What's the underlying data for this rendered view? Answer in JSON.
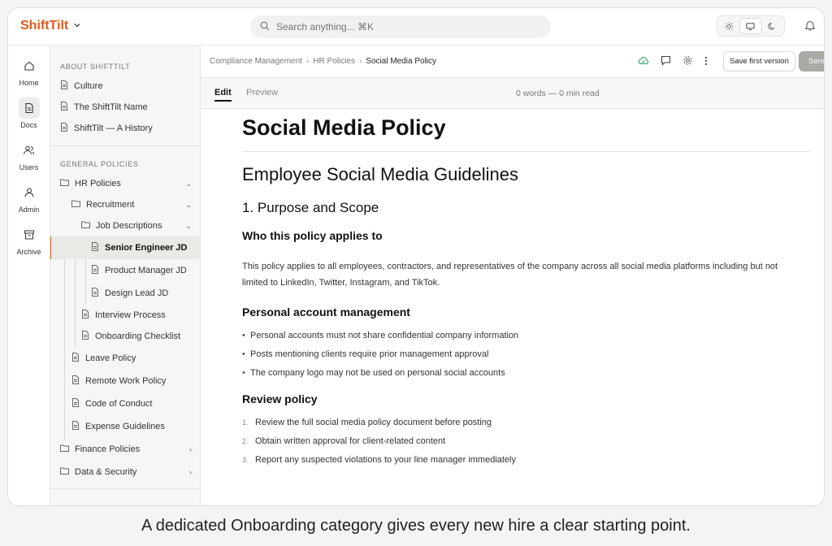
{
  "app": {
    "brand": "ShiftTilt"
  },
  "search": {
    "placeholder": "Search anything... ⌘K"
  },
  "theme_toggle": [
    "light",
    "system",
    "dark"
  ],
  "rail": [
    {
      "label": "Home",
      "icon": "home-icon"
    },
    {
      "label": "Docs",
      "icon": "document-icon",
      "active": true
    },
    {
      "label": "Users",
      "icon": "users-icon"
    },
    {
      "label": "Admin",
      "icon": "admin-icon"
    },
    {
      "label": "Archive",
      "icon": "archive-icon"
    }
  ],
  "sidebar": {
    "about_title": "ABOUT SHIFTTILT",
    "about_items": [
      "Culture",
      "The ShiftTilt Name",
      "ShiftTilt — A History"
    ],
    "general_title": "GENERAL POLICIES",
    "tree": {
      "hr": "HR Policies",
      "recruitment": "Recruitment",
      "job_descriptions": "Job Descriptions",
      "senior": "Senior Engineer JD",
      "product": "Product Manager JD",
      "design": "Design Lead JD",
      "interview": "Interview Process",
      "onboarding": "Onboarding Checklist",
      "leave": "Leave Policy",
      "remote": "Remote Work Policy",
      "conduct": "Code of Conduct",
      "expense": "Expense Guidelines",
      "finance": "Finance Policies",
      "data": "Data & Security"
    }
  },
  "breadcrumb": [
    "Compliance Management",
    "HR Policies",
    "Social Media Policy"
  ],
  "toolbar": {
    "save_label": "Save first version",
    "send_label": "Send"
  },
  "editor": {
    "tab_edit": "Edit",
    "tab_preview": "Preview",
    "word_count": "0 words — 0 min read"
  },
  "doc": {
    "title": "Social Media Policy",
    "h2": "Employee Social Media Guidelines",
    "h3": "1. Purpose and Scope",
    "h4_applies": "Who this policy applies to",
    "para": "This policy applies to all employees, contractors, and representatives of the company across all social media platforms including but not limited to LinkedIn, Twitter, Instagram, and TikTok.",
    "h4_personal": "Personal account management",
    "bullets": [
      "Personal accounts must not share confidential company information",
      "Posts mentioning clients require prior management approval",
      "The company logo may not be used on personal social accounts"
    ],
    "h4_review": "Review policy",
    "steps": [
      {
        "n": "1.",
        "text": "Review the full social media policy document before posting"
      },
      {
        "n": "2.",
        "text": "Obtain written approval for client-related content"
      },
      {
        "n": "3.",
        "text": "Report any suspected violations to your line manager immediately"
      }
    ]
  },
  "caption": "A dedicated Onboarding category gives every new hire a clear starting point.",
  "colors": {
    "accent": "#e05a1c",
    "cloud_status": "#2fa36b"
  }
}
